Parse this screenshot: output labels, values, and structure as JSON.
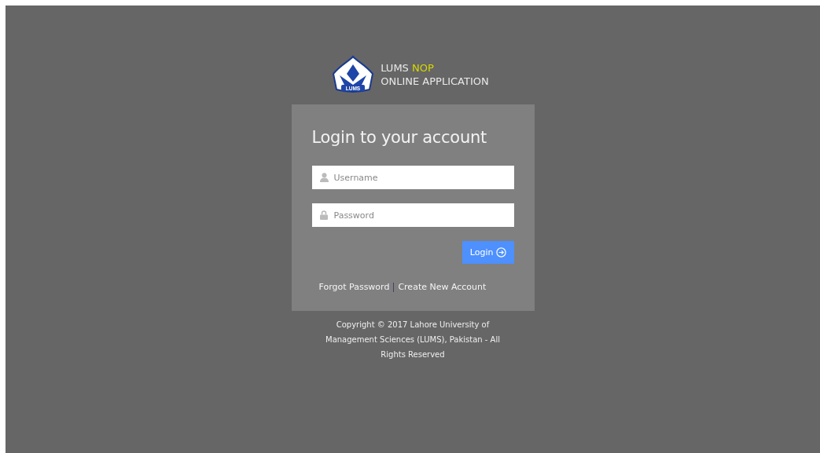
{
  "logo": {
    "name": "LUMS",
    "highlight": "NOP",
    "subtitle": "ONLINE APPLICATION",
    "emblem_text": "LUMS"
  },
  "login": {
    "title": "Login to your account",
    "fields": [
      {
        "kind": "user",
        "placeholder": "Username"
      },
      {
        "kind": "lock",
        "placeholder": "Password"
      }
    ],
    "button": "Login",
    "links": [
      "Forgot Password",
      "Create New Account"
    ]
  },
  "footer": "Copyright © 2017 Lahore University of Management Sciences (LUMS), Pakistan - All Rights Reserved"
}
